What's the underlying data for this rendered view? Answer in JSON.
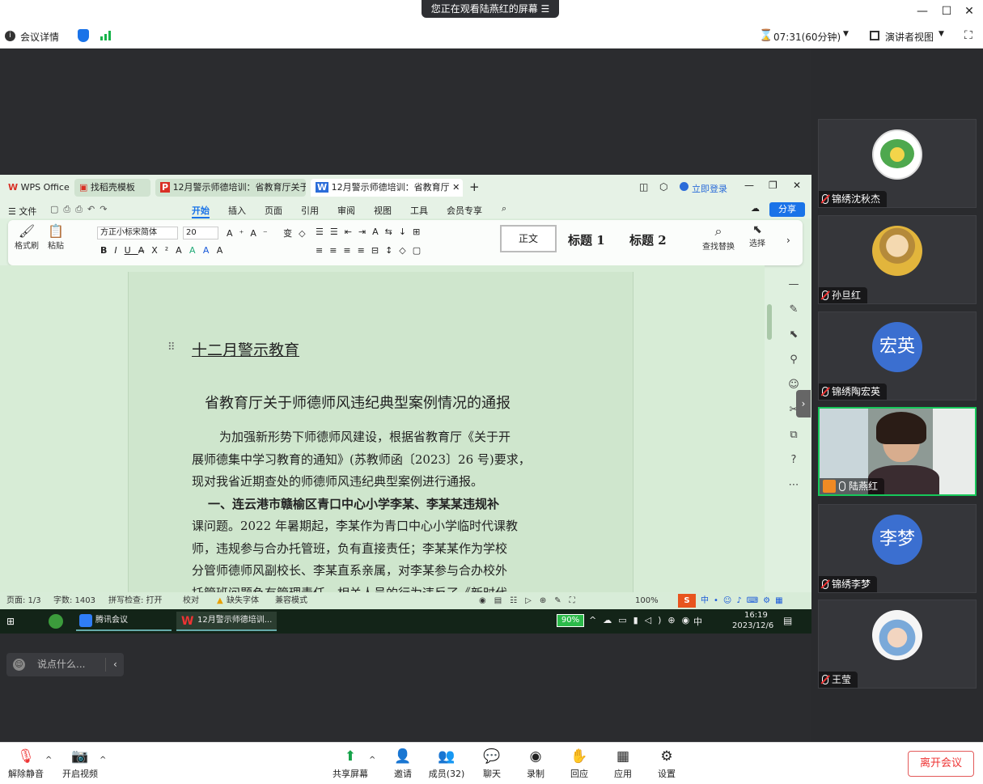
{
  "window": {
    "share_notice": "您正在观看陆燕红的屏幕",
    "minimize": "—",
    "maximize": "☐",
    "close": "✕"
  },
  "meeting_bar": {
    "details_label": "会议详情",
    "timer": "07:31(60分钟)",
    "view_mode": "演讲者视图"
  },
  "wps": {
    "tabs": [
      {
        "label": "WPS Office"
      },
      {
        "label": "找稻壳模板"
      },
      {
        "label": "12月警示师德培训：省教育厅关于师"
      },
      {
        "label": "12月警示师德培训：省教育厅"
      }
    ],
    "login_label": "立即登录",
    "menu": [
      "文件",
      "开始",
      "插入",
      "页面",
      "引用",
      "审阅",
      "视图",
      "工具",
      "会员专享"
    ],
    "share_label": "分享",
    "ribbon": {
      "format_painter": "格式刷",
      "paste": "粘贴",
      "font_name": "方正小标宋简体",
      "font_size": "20",
      "style_normal": "正文",
      "style_h1": "标题 1",
      "style_h2": "标题 2",
      "find_replace": "查找替换",
      "select": "选择"
    },
    "document": {
      "section_title": "十二月警示教育",
      "heading": "省教育厅关于师德师风违纪典型案例情况的通报",
      "lines": [
        "为加强新形势下师德师风建设，根据省教育厅《关于开",
        "展师德集中学习教育的通知》(苏教师函〔2023〕26 号)要求，",
        "现对我省近期查处的师德师风违纪典型案例进行通报。",
        "一、连云港市赣榆区青口中心小学李某、李某某违规补",
        "课问题。2022 年暑期起，李某作为青口中心小学临时代课教",
        "师，违规参与合办托管班，负有直接责任；李某某作为学校",
        "分管师德师风副校长、李某直系亲属，对李某参与合办校外",
        "托管班问题负有管理责任。相关人员的行为违反了《新时代"
      ]
    },
    "status": {
      "page": "页面: 1/3",
      "words": "字数: 1403",
      "spell": "拼写检查: 打开",
      "proof": "校对",
      "missing_font": "缺失字体",
      "compat": "兼容模式",
      "zoom": "100%"
    }
  },
  "taskbar": {
    "apps": [
      {
        "label": "腾讯会议"
      },
      {
        "label": "12月警示师德培训..."
      }
    ],
    "battery": "90%",
    "ime": "中",
    "time": "16:19",
    "date": "2023/12/6"
  },
  "chat": {
    "placeholder": "说点什么..."
  },
  "participants": [
    {
      "name": "锦绣沈秋杰",
      "avatar": "logo"
    },
    {
      "name": "孙旦红",
      "avatar": "photo"
    },
    {
      "name": "锦绣陶宏英",
      "avatar": "text",
      "initials": "宏英"
    },
    {
      "name": "陆燕红",
      "avatar": "video"
    },
    {
      "name": "锦绣李梦",
      "avatar": "text",
      "initials": "李梦"
    },
    {
      "name": "王莹",
      "avatar": "photo"
    }
  ],
  "toolbar": {
    "unmute": "解除静音",
    "video": "开启视频",
    "share_screen": "共享屏幕",
    "invite": "邀请",
    "members": "成员(32)",
    "chat": "聊天",
    "record": "录制",
    "react": "回应",
    "apps": "应用",
    "settings": "设置",
    "leave": "离开会议"
  },
  "colors": {
    "accent": "#1a73e8",
    "avatar_blue": "#3b6fd0",
    "active_border": "#16c85a",
    "wps_green": "#dff0df",
    "leave_red": "#e33"
  }
}
